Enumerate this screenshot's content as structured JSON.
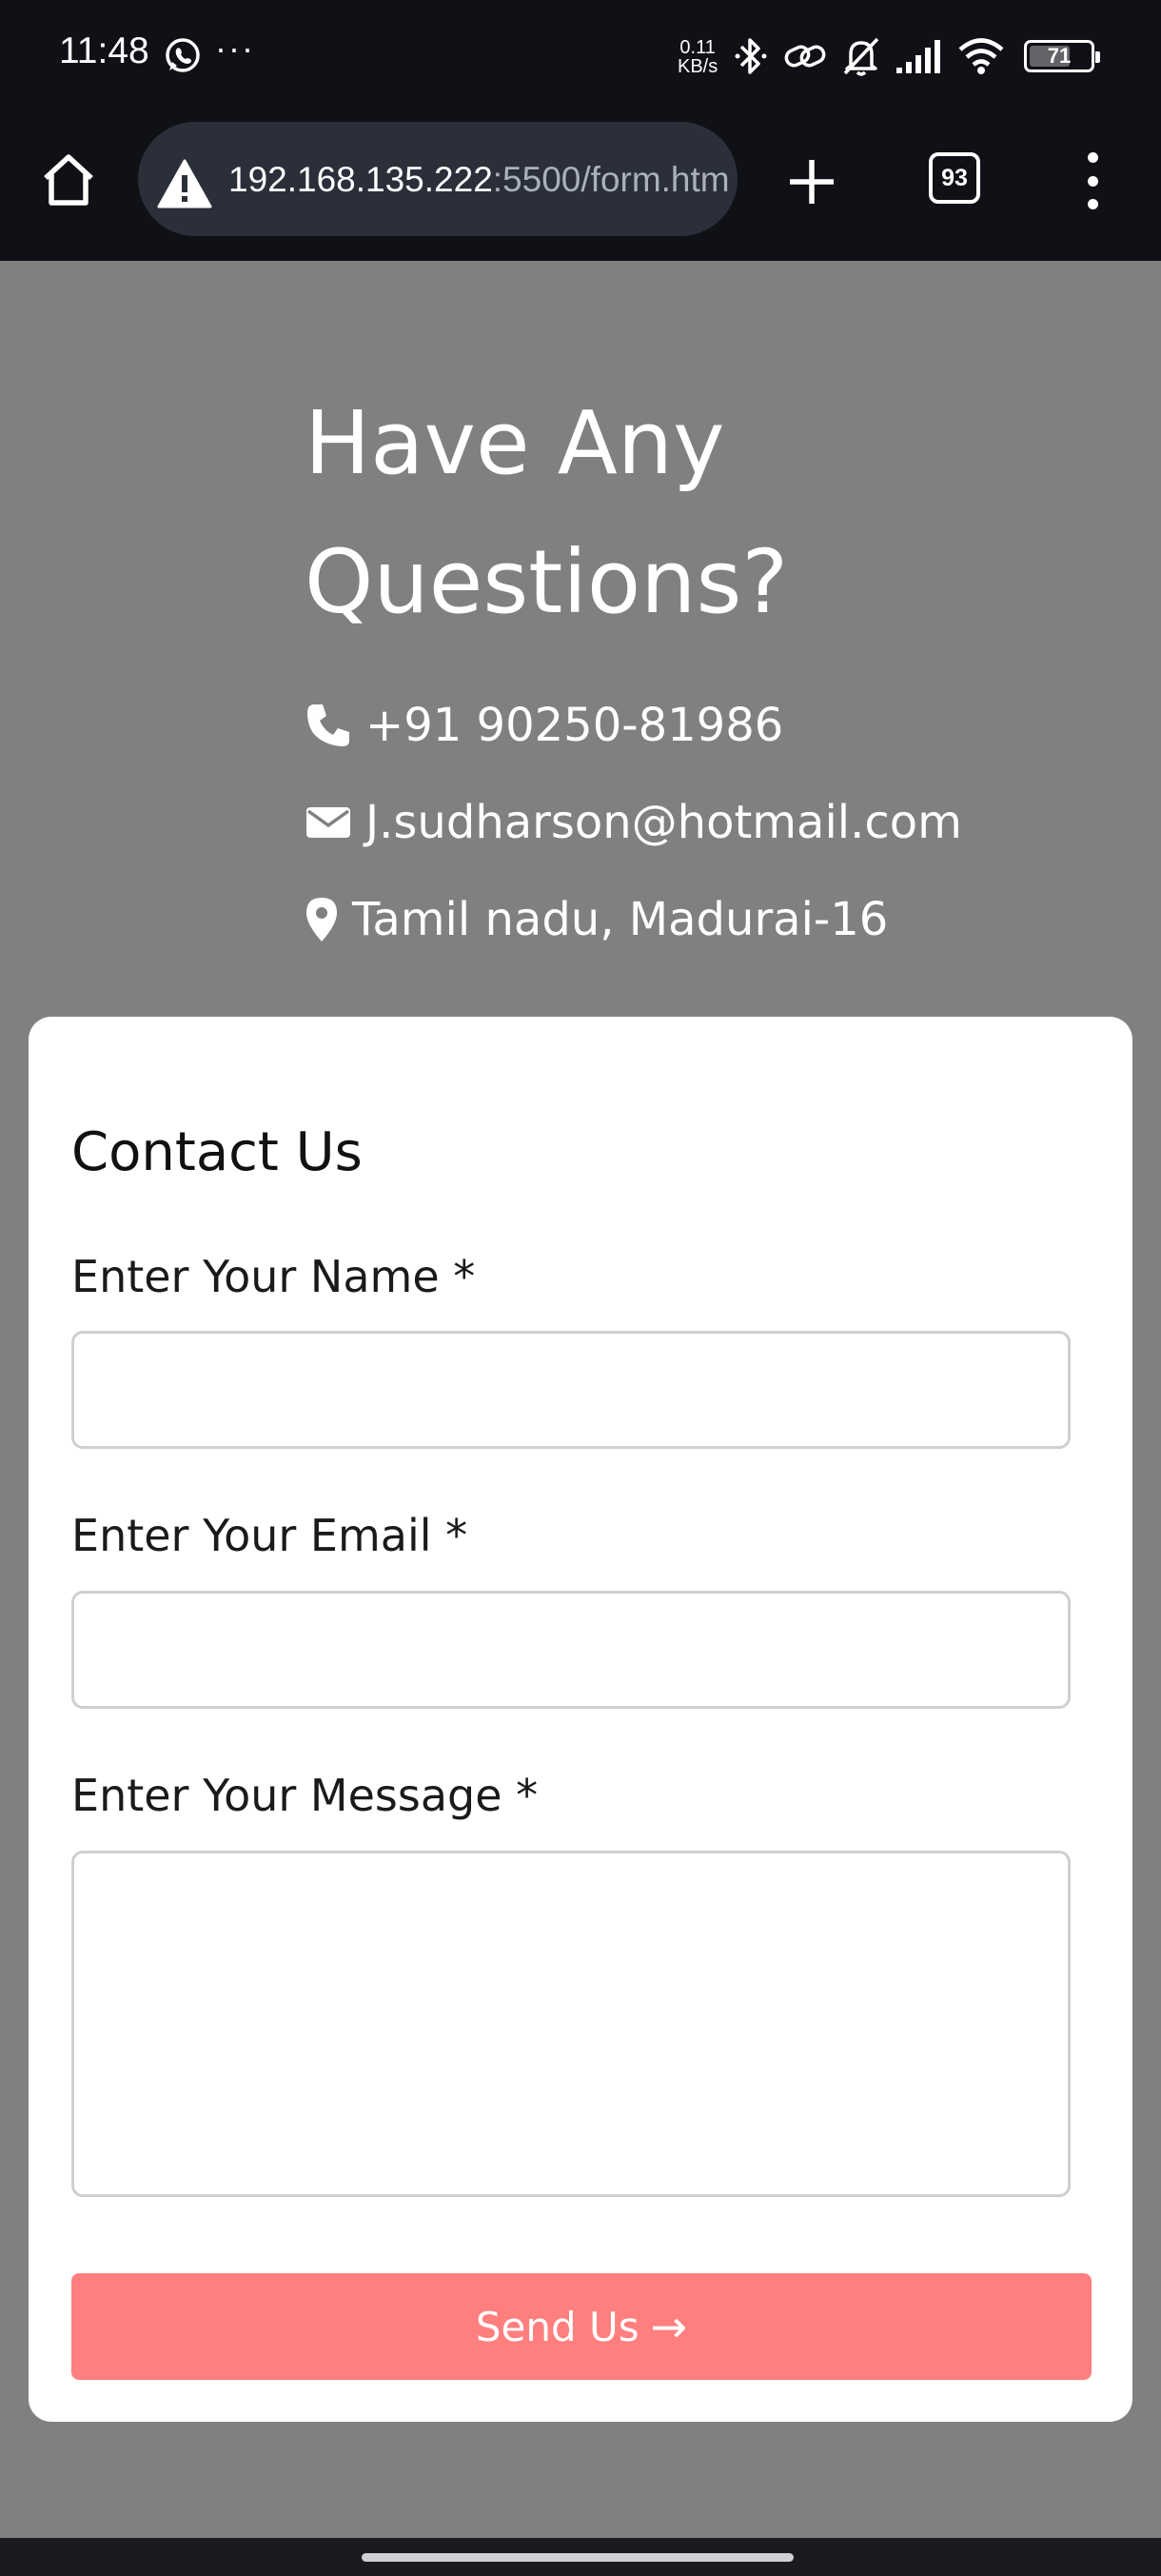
{
  "status_bar": {
    "time": "11:48",
    "more_indicator": "···",
    "net_speed_value": "0.11",
    "net_speed_unit": "KB/s",
    "battery": "71",
    "battery_level_percent": 71,
    "icons": [
      "whatsapp-icon",
      "bluetooth-icon",
      "link-icon",
      "bell-off-icon",
      "signal-icon",
      "wifi-icon",
      "battery-icon"
    ]
  },
  "browser": {
    "url_host": "192.168.135.222",
    "url_rest": ":5500/form.htm",
    "tab_count": "93",
    "icons": [
      "home-icon",
      "warning-icon",
      "plus-icon",
      "tabs-icon",
      "more-vert-icon"
    ]
  },
  "hero": {
    "title_line1": "Have Any",
    "title_line2": "Questions?",
    "phone": "+91 90250-81986",
    "email": "J.sudharson@hotmail.com",
    "location": "Tamil nadu, Madurai-16"
  },
  "form": {
    "title": "Contact Us",
    "name_label": "Enter Your Name *",
    "name_value": "",
    "email_label": "Enter Your Email *",
    "email_value": "",
    "message_label": "Enter Your Message *",
    "message_value": "",
    "submit_label": "Send Us",
    "submit_arrow": "→"
  },
  "colors": {
    "page_background": "#808080",
    "system_bar": "#101116",
    "url_box": "#2b2f3a",
    "card": "#ffffff",
    "button": "#ff7f7f",
    "text_light": "#ffffff",
    "text_dark": "#111111"
  }
}
